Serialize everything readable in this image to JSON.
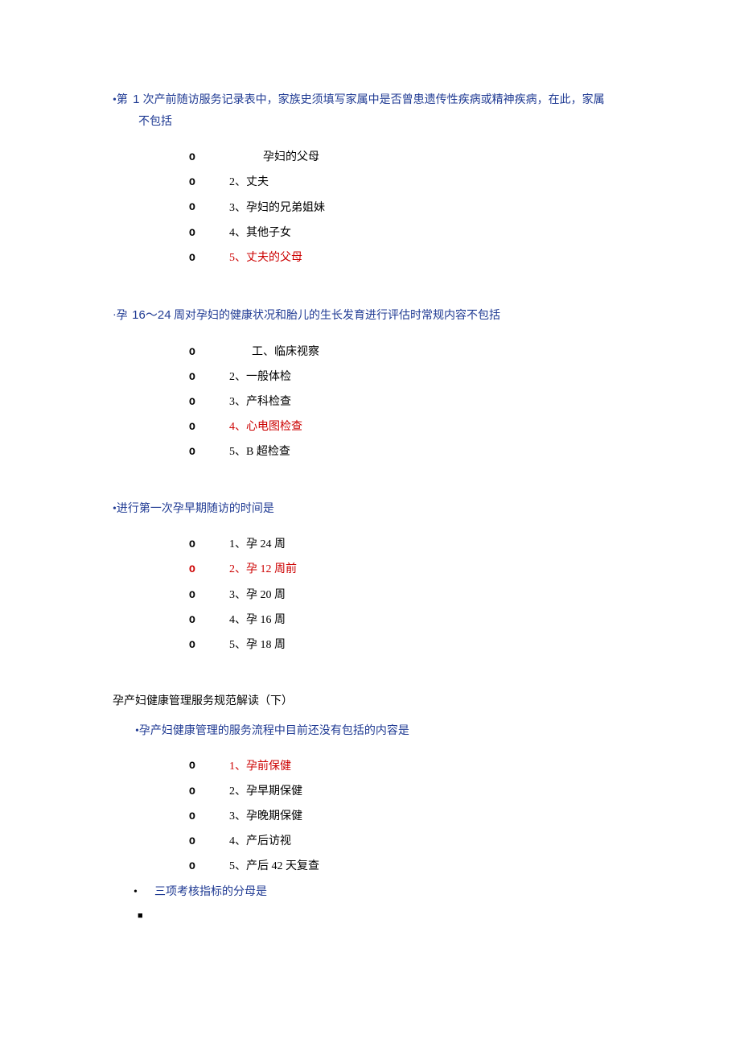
{
  "questions": [
    {
      "prompt_pre": "•第",
      "prompt_num": " 1 ",
      "prompt_post": "次产前随访服务记录表中，家族史须填写家属中是否曾患遗传性疾病或精神疾病，在此，家属",
      "prompt_line2": "不包括",
      "options": [
        {
          "text": "　　　孕妇的父母",
          "answer": false
        },
        {
          "text": "2、丈夫",
          "answer": false
        },
        {
          "text": "3、孕妇的兄弟姐妹",
          "answer": false
        },
        {
          "text": "4、其他子女",
          "answer": false
        },
        {
          "text": "5、丈夫的父母",
          "answer": true
        }
      ]
    },
    {
      "prompt_pre": "·孕 ",
      "prompt_num": "16～24",
      "prompt_post": " 周对孕妇的健康状况和胎儿的生长发育进行评估时常规内容不包括",
      "prompt_line2": "",
      "options": [
        {
          "text": "　　工、临床视察",
          "answer": false
        },
        {
          "text": "2、一般体检",
          "answer": false
        },
        {
          "text": "3、产科检查",
          "answer": false
        },
        {
          "text": "4、心电图检查",
          "answer": true
        },
        {
          "text": "5、B 超检查",
          "answer": false
        }
      ]
    },
    {
      "prompt_pre": "",
      "prompt_num": "",
      "prompt_post": "•进行第一次孕早期随访的时间是",
      "prompt_line2": "",
      "options": [
        {
          "text": "1、孕 24 周",
          "answer": false
        },
        {
          "text": "2、孕 12 周前",
          "answer": true
        },
        {
          "text": "3、孕 20 周",
          "answer": false
        },
        {
          "text": "4、孕 16 周",
          "answer": false
        },
        {
          "text": "5、孕 18 周",
          "answer": false
        }
      ]
    }
  ],
  "section_heading": "孕产妇健康管理服务规范解读（下）",
  "sub_question_prompt": "•孕产妇健康管理的服务流程中目前还没有包括的内容是",
  "sub_options": [
    {
      "text": "1、孕前保健",
      "answer": true
    },
    {
      "text": "2、孕早期保健",
      "answer": false
    },
    {
      "text": "3、孕晚期保健",
      "answer": false
    },
    {
      "text": "4、产后访视",
      "answer": false
    },
    {
      "text": "5、产后 42 天复查",
      "answer": false
    }
  ],
  "trailing_question": "三项考核指标的分母是",
  "bullet_char": "O"
}
